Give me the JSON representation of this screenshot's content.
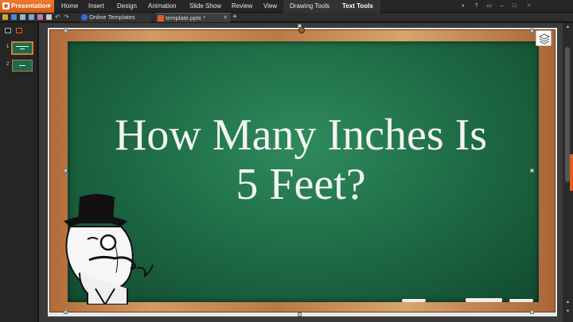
{
  "app": {
    "name": "Presentation"
  },
  "menu": [
    "Home",
    "Insert",
    "Design",
    "Animation",
    "Slide Show",
    "Review",
    "View",
    "Drawing Tools",
    "Text Tools"
  ],
  "tabs": [
    {
      "label": "Online Templates"
    },
    {
      "label": "template.pptx *"
    }
  ],
  "thumbnails": [
    {
      "number": "1"
    },
    {
      "number": "2"
    }
  ],
  "slide": {
    "title_line1": "How Many Inches Is",
    "title_line2": "5 Feet?"
  },
  "colors": {
    "accent": "#e0601b",
    "board": "#1f6e47",
    "frame": "#c88a52"
  },
  "icons": [
    "app-logo-icon",
    "save-icon",
    "undo-icon",
    "redo-icon",
    "close-icon",
    "add-icon",
    "layers-icon",
    "text-cursor-icon"
  ]
}
